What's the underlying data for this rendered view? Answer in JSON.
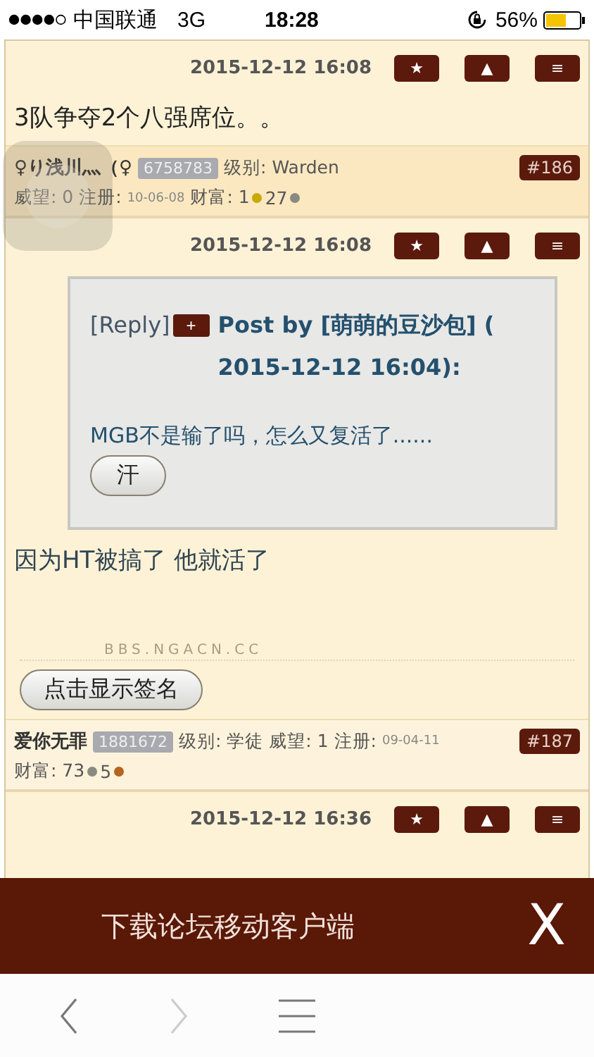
{
  "status_bar": {
    "carrier": "中国联通",
    "network": "3G",
    "time": "18:28",
    "battery": "56%"
  },
  "blocks": [
    {
      "kind": "header",
      "time": "2015-12-12 16:08",
      "buttons": [
        "★",
        "▲",
        "≡"
      ]
    },
    {
      "kind": "text",
      "text": "3队争夺2个八强席位。。"
    },
    {
      "kind": "user",
      "floor": "#186",
      "lines": [
        [
          {
            "kind": "name",
            "text": "♀り浅川灬（♀"
          },
          {
            "kind": "uid",
            "text": "6758783"
          },
          {
            "kind": "text",
            "text": "级别: Warden"
          }
        ],
        [
          {
            "kind": "text",
            "text": "威望: 0 注册:"
          },
          {
            "kind": "small",
            "text": "10-06-08"
          },
          {
            "kind": "text",
            "text": "财富: 1"
          },
          {
            "kind": "coin",
            "color": "#c9a800"
          },
          {
            "kind": "text",
            "text": "27"
          },
          {
            "kind": "coin",
            "color": "#8a8a80"
          }
        ]
      ]
    },
    {
      "kind": "header",
      "time": "2015-12-12 16:08",
      "buttons": [
        "★",
        "▲",
        "≡"
      ]
    },
    {
      "kind": "quote",
      "reply": "[Reply]",
      "plus": "+",
      "title": "Post by [萌萌的豆沙包] ( 2015-12-12 16:04):",
      "text": "MGB不是输了吗，怎么又复活了......",
      "button": "汗"
    },
    {
      "kind": "text",
      "text": "因为HT被搞了 他就活了"
    },
    {
      "kind": "signature",
      "mark": "BBS.NGACN.CC",
      "button": "点击显示签名"
    },
    {
      "kind": "user",
      "floor": "#187",
      "lines": [
        [
          {
            "kind": "name",
            "text": "爱你无罪"
          },
          {
            "kind": "uid",
            "text": "1881672"
          },
          {
            "kind": "text",
            "text": "级别: 学徒 威望: 1 注册:"
          },
          {
            "kind": "small",
            "text": "09-04-11"
          }
        ],
        [
          {
            "kind": "text",
            "text": "财富: 73"
          },
          {
            "kind": "coin",
            "color": "#8a8a80"
          },
          {
            "kind": "text",
            "text": "5"
          },
          {
            "kind": "coin",
            "color": "#b5651d"
          }
        ]
      ]
    },
    {
      "kind": "header",
      "time": "2015-12-12 16:36",
      "buttons": [
        "★",
        "▲",
        "≡"
      ]
    }
  ],
  "banner": {
    "text": "下载论坛移动客户端",
    "close": "X"
  },
  "toolbar": [
    {
      "kind": "back",
      "disabled": false
    },
    {
      "kind": "forward",
      "disabled": true
    },
    {
      "kind": "menu",
      "disabled": false
    }
  ]
}
